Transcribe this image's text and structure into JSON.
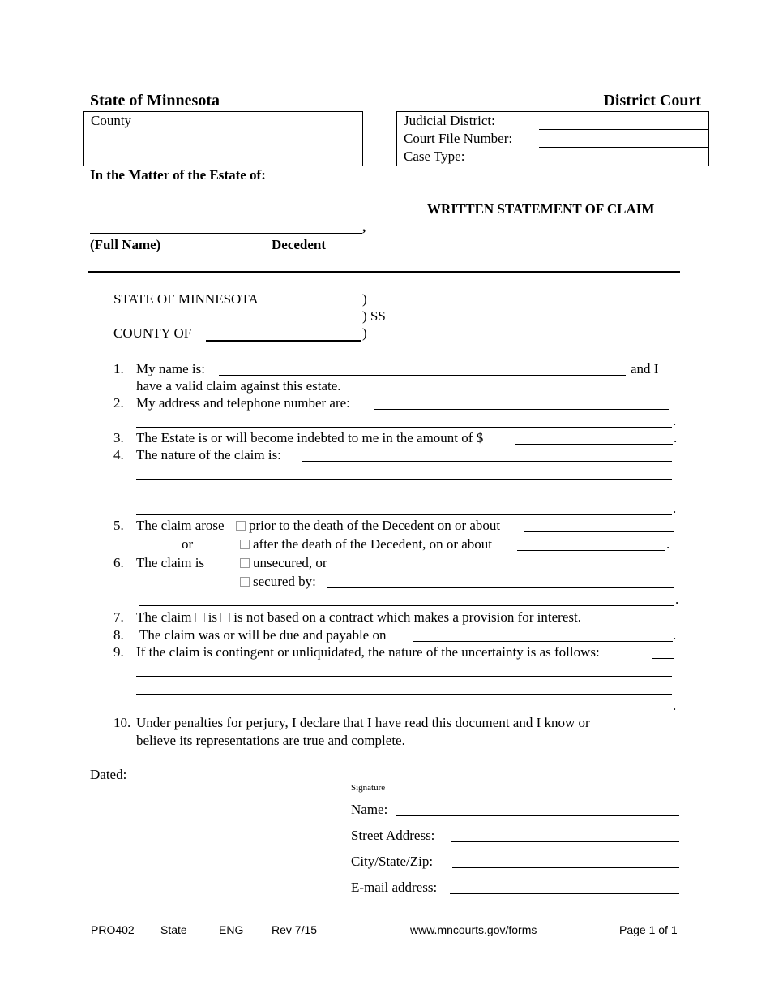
{
  "header": {
    "state": "State of Minnesota",
    "court": "District Court",
    "county_label": "County",
    "judicial_district_label": "Judicial District:",
    "court_file_number_label": "Court File Number:",
    "case_type_label": "Case Type:"
  },
  "caption": {
    "matter_label": "In the Matter of the Estate of:",
    "comma": ",",
    "full_name_label": "(Full Name)",
    "decedent_label": "Decedent",
    "title": "WRITTEN STATEMENT OF CLAIM"
  },
  "venue": {
    "state_line": "STATE OF MINNESOTA",
    "county_line": "COUNTY OF",
    "paren1": ")",
    "paren2": ") SS",
    "paren3": ")"
  },
  "items": {
    "i1_num": "1.",
    "i1_text": "My name is:",
    "i1_tail": "and I",
    "i1_cont": "have a valid claim against this estate.",
    "i2_num": "2.",
    "i2_text": "My address and telephone number are:",
    "i3_num": "3.",
    "i3_text": "The Estate is or will become indebted to me in the amount of $",
    "i4_num": "4.",
    "i4_text": "The nature of the claim is:",
    "i5_num": "5.",
    "i5_text": "The claim arose",
    "i5_opt1": "prior to the death of the Decedent on or about",
    "i5_or": "or",
    "i5_opt2": "after the death of the Decedent, on or about",
    "i6_num": "6.",
    "i6_text": "The claim is",
    "i6_opt1": "unsecured, or",
    "i6_opt2": "secured by:",
    "i7_num": "7.",
    "i7_a": "The claim",
    "i7_b": "is",
    "i7_c": "is not based on a contract which makes a provision for interest.",
    "i8_num": "8.",
    "i8_text": "The claim was or will be due and payable on",
    "i9_num": "9.",
    "i9_text": "If the claim is contingent or unliquidated, the nature of the uncertainty is as follows:",
    "i10_num": "10.",
    "i10_text": "Under penalties for perjury, I declare that I have read this document and I know or",
    "i10_cont": "believe its representations are true and complete.",
    "period": "."
  },
  "signature": {
    "dated_label": "Dated:",
    "signature_label": "Signature",
    "name_label": "Name:",
    "street_label": "Street Address:",
    "city_label": "City/State/Zip:",
    "email_label": "E-mail address:"
  },
  "footer": {
    "form_id": "PRO402",
    "jurisdiction": "State",
    "language": "ENG",
    "revision": "Rev 7/15",
    "url": "www.mncourts.gov/forms",
    "page": "Page 1 of 1"
  }
}
